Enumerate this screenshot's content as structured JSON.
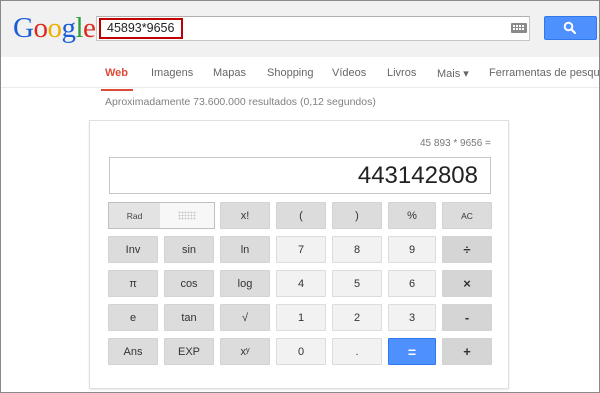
{
  "logo": {
    "letters": [
      "G",
      "o",
      "o",
      "g",
      "l",
      "e"
    ],
    "colors": [
      "#1a5dd6",
      "#d82d20",
      "#f0b000",
      "#1a5dd6",
      "#2c9f3a",
      "#d82d20"
    ]
  },
  "search": {
    "query": "45893*9656"
  },
  "tabs": [
    "Web",
    "Imagens",
    "Mapas",
    "Shopping",
    "Vídeos",
    "Livros",
    "Mais ▾",
    "Ferramentas de pesquisa"
  ],
  "result_stats": "Aproximadamente 73.600.000 resultados (0,12 segundos)",
  "calculator": {
    "expression": "45 893 * 9656 =",
    "result": "443142808",
    "mode_rad": "Rad",
    "keys": {
      "fact": "x!",
      "lparen": "(",
      "rparen": ")",
      "percent": "%",
      "ac": "AC",
      "inv": "Inv",
      "sin": "sin",
      "ln": "ln",
      "seven": "7",
      "eight": "8",
      "nine": "9",
      "divide": "÷",
      "pi": "π",
      "cos": "cos",
      "log": "log",
      "four": "4",
      "five": "5",
      "six": "6",
      "times": "×",
      "e": "e",
      "tan": "tan",
      "sqrt": "√",
      "one": "1",
      "two": "2",
      "three": "3",
      "minus": "-",
      "ans": "Ans",
      "exp": "EXP",
      "pow": "xʸ",
      "zero": "0",
      "dot": ".",
      "equals": "=",
      "plus": "+"
    }
  },
  "colors": {
    "accent": "#4d90fe",
    "active_tab": "#dd4b39",
    "highlight": "#c00000"
  }
}
